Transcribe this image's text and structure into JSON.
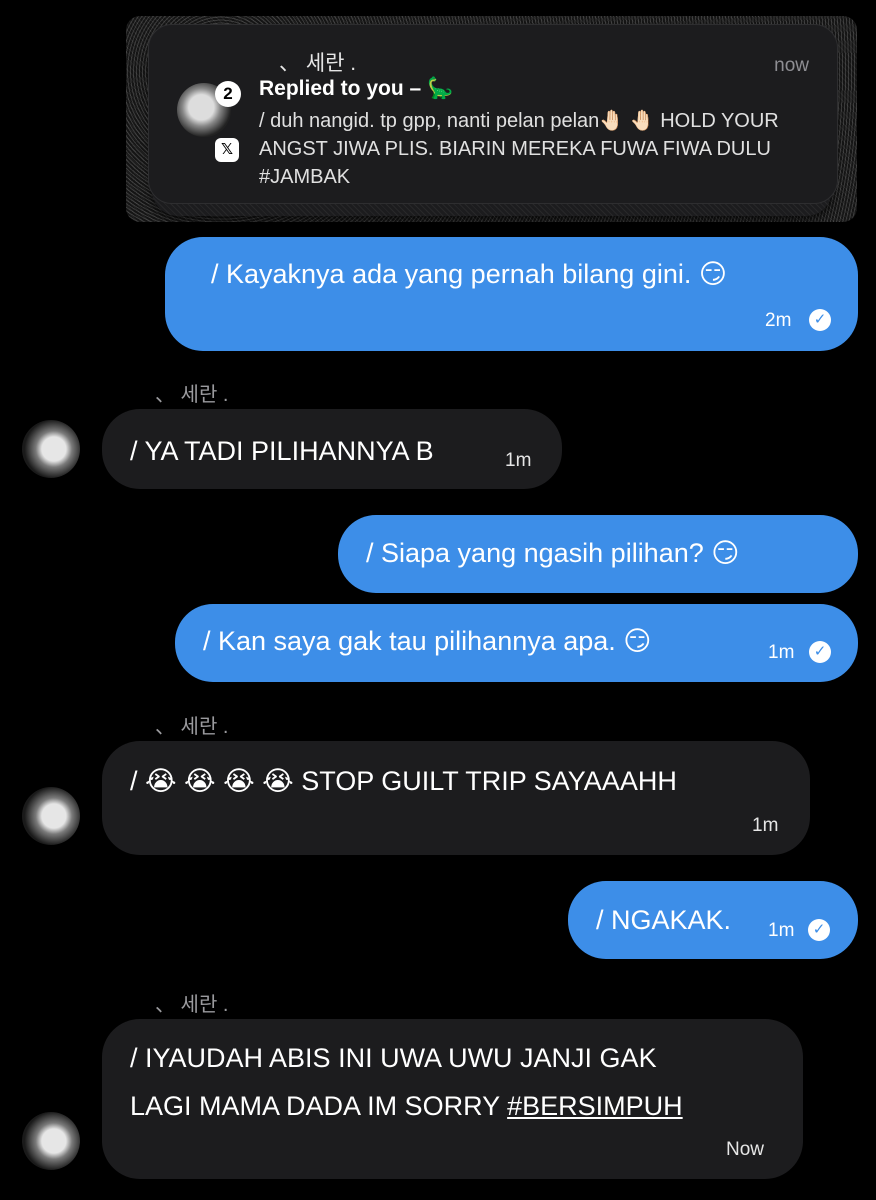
{
  "notification": {
    "sender": "、  세란 .",
    "time": "now",
    "badge": "2",
    "app_icon": "x-logo-icon",
    "title": "Replied to you – 🦕",
    "body": "/ duh nangid. tp gpp, nanti pelan pelan🤚🏻 🤚🏻 HOLD YOUR ANGST JIWA PLIS. BIARIN MEREKA FUWA FIWA DULU #JAMBAK"
  },
  "messages": [
    {
      "id": "m1",
      "direction": "outgoing",
      "text": "/ Kayaknya ada yang pernah bilang gini. 😏",
      "time": "2m",
      "read": true
    },
    {
      "id": "m2",
      "direction": "incoming",
      "sender": "、  세란 .",
      "text": "/ YA TADI PILIHANNYA B",
      "time": "1m"
    },
    {
      "id": "m3",
      "direction": "outgoing",
      "text": "/ Siapa yang ngasih pilihan? 😏"
    },
    {
      "id": "m4",
      "direction": "outgoing",
      "text": "/ Kan saya gak tau pilihannya apa. 😏",
      "time": "1m",
      "read": true
    },
    {
      "id": "m5",
      "direction": "incoming",
      "sender": "、  세란 .",
      "text": "/ 😭 😭 😭 😭  STOP GUILT TRIP SAYAAAHH",
      "time": "1m"
    },
    {
      "id": "m6",
      "direction": "outgoing",
      "text": "/ NGAKAK.",
      "time": "1m",
      "read": true
    },
    {
      "id": "m7",
      "direction": "incoming",
      "sender": "、  세란 .",
      "text_line1": "/ IYAUDAH ABIS INI UWA UWU JANJI GAK",
      "text_line2": "LAGI MAMA DADA IM SORRY ",
      "hashtag": "#BERSIMPUH",
      "time": "Now"
    }
  ],
  "colors": {
    "outgoing_bubble": "#3d8ee8",
    "incoming_bubble": "#1c1c1e",
    "background": "#000000"
  }
}
